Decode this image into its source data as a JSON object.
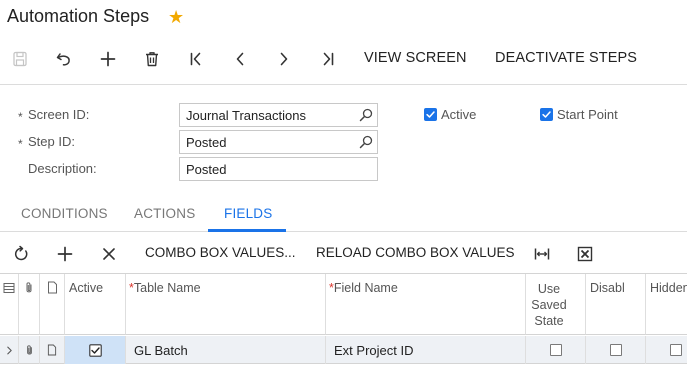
{
  "title": {
    "text": "Automation Steps",
    "favorite_icon": "star-icon"
  },
  "toolbar": {
    "save_icon": "save-icon",
    "undo_icon": "undo-icon",
    "add_icon": "plus-icon",
    "delete_icon": "trash-icon",
    "first_icon": "first-record-icon",
    "prev_icon": "previous-record-icon",
    "next_icon": "next-record-icon",
    "last_icon": "last-record-icon",
    "view_screen_label": "VIEW SCREEN",
    "deactivate_steps_label": "DEACTIVATE STEPS"
  },
  "form": {
    "screen_id": {
      "label": "Screen ID:",
      "value": "Journal Transactions",
      "required": "*"
    },
    "step_id": {
      "label": "Step ID:",
      "value": "Posted",
      "required": "*"
    },
    "description": {
      "label": "Description:",
      "value": "Posted"
    },
    "active": {
      "label": "Active",
      "checked": true
    },
    "start_point": {
      "label": "Start Point",
      "checked": true
    }
  },
  "tabs": [
    {
      "label": "CONDITIONS",
      "active": false
    },
    {
      "label": "ACTIONS",
      "active": false
    },
    {
      "label": "FIELDS",
      "active": true
    }
  ],
  "grid_toolbar": {
    "refresh_icon": "refresh-icon",
    "add_icon": "plus-icon",
    "delete_icon": "close-icon",
    "combo_values_label": "COMBO BOX VALUES...",
    "reload_combo_label": "RELOAD COMBO BOX VALUES",
    "fit_columns_icon": "fit-columns-icon",
    "export_excel_icon": "excel-export-icon"
  },
  "grid": {
    "columns": {
      "active": "Active",
      "table_name": "Table Name",
      "field_name": "Field Name",
      "use_saved_state_1": "Use",
      "use_saved_state_2": "Saved",
      "use_saved_state_3": "State",
      "disabled": "Disabl",
      "hidden": "Hidden",
      "required_marker": "*"
    },
    "rows": [
      {
        "active": true,
        "table_name": "GL Batch",
        "field_name": "Ext Project ID",
        "use_saved_state": false,
        "disabled": false,
        "hidden": false
      }
    ]
  },
  "colors": {
    "accent": "#1a73e8",
    "star": "#f2a900",
    "required": "#d9342b",
    "row_selected": "#eef1f5",
    "active_cell": "#cfe2f7"
  }
}
